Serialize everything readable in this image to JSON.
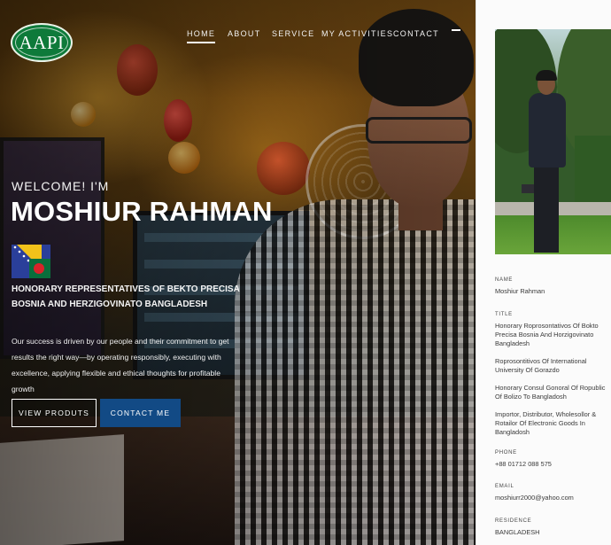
{
  "logo": {
    "text": "AAPI"
  },
  "nav": {
    "items": [
      {
        "label": "HOME",
        "active": true
      },
      {
        "label": "ABOUT",
        "active": false
      },
      {
        "label": "SERVICE",
        "active": false
      },
      {
        "label": "MY ACTIVITIES",
        "active": false
      },
      {
        "label": "CONTACT",
        "active": false
      }
    ]
  },
  "hero": {
    "welcome": "WELCOME! I'M",
    "name": "MOSHIUR RAHMAN",
    "role": "HONORARY REPRESENTATIVES OF BEKTO PRECISA BOSNIA AND HERZIGOVINATO BANGLADESH",
    "description": "Our success is driven by our people and their commitment to get results the right way—by operating responsibly, executing with excellence, applying flexible and ethical thoughts for profitable growth",
    "buttons": {
      "view_products": "VIEW PRODUTS",
      "contact_me": "CONTACT ME"
    }
  },
  "profile": {
    "name_label": "NAME",
    "name_value": "Moshiur Rahman",
    "title_label": "TITLE",
    "titles": [
      "Honorary Roprosontativos Of Bokto Precisa Bosnia And Horzigovinato Bangladesh",
      "Roprosontitivos Of International University Of Gorazdo",
      "Honorary Consul Gonoral Of Ropublic Of Bolizo To Bangladosh",
      "Importor, Distributor, Wholesollor & Rotailor Of Electronic Goods In Bangladosh"
    ],
    "phone_label": "PHONE",
    "phone_value": "+88 01712 088 575",
    "email_label": "EMAIL",
    "email_value": "moshiurr2000@yahoo.com",
    "residence_label": "RESIDENCE",
    "residence_value": "BANGLADESH"
  },
  "colors": {
    "accent_button": "#124a85",
    "logo_green": "#0e7a3a",
    "panel_bg": "#fbfbfb"
  }
}
